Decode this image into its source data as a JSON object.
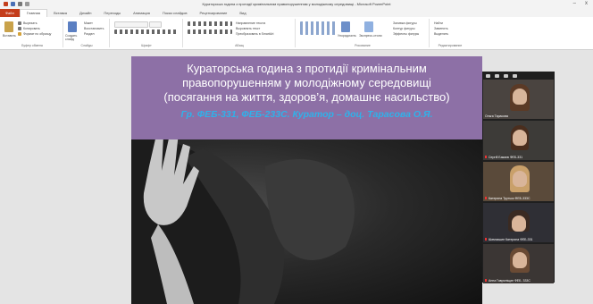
{
  "window": {
    "title": "Кураторська година з протидії кримінальним правопорушенням у молодіжному середовищі - Microsoft PowerPoint",
    "minimize": "–",
    "close": "x"
  },
  "tabs": [
    "Файл",
    "Главная",
    "Вставка",
    "Дизайн",
    "Переходы",
    "Анимация",
    "Показ слайдов",
    "Рецензирование",
    "Вид"
  ],
  "ribbon": {
    "clipboard": {
      "label": "Буфер обмена",
      "paste": "Вставить",
      "cut": "Вырезать",
      "copy": "Копировать",
      "format": "Формат по образцу"
    },
    "slides": {
      "label": "Слайды",
      "new_slide": "Создать слайд",
      "layout": "Макет",
      "reset": "Восстановить",
      "section": "Раздел"
    },
    "font": {
      "label": "Шрифт"
    },
    "paragraph": {
      "label": "Абзац",
      "text_dir": "Направление текста",
      "align_text": "Выровнять текст",
      "smartart": "Преобразовать в SmartArt"
    },
    "drawing": {
      "label": "Рисование",
      "arrange": "Упорядочить",
      "quick_styles": "Экспресс-стили",
      "fill": "Заливка фигуры",
      "outline": "Контур фигуры",
      "effects": "Эффекты фигуры"
    },
    "editing": {
      "label": "Редактирование",
      "find": "Найти",
      "replace": "Заменить",
      "select": "Выделить"
    }
  },
  "slide": {
    "title_line1": "Кураторська година з протидії кримінальним",
    "title_line2": "правопорушенням у молодіжному середовищі",
    "title_line3": "(посягання на життя, здоров’я, домашнє насильство)",
    "curator_line": "Гр. ФЕБ-331, ФЕБ-233С. Куратор – доц. Тарасова О.Я."
  },
  "participants": [
    {
      "name": "Ольга Тарасова"
    },
    {
      "name": "Сергій Бакаєв ФЕБ-331"
    },
    {
      "name": "Катерина Трутько ФЕБ-333С"
    },
    {
      "name": "Шимчишин Катерина ФЕБ-331"
    },
    {
      "name": "Анна Гавриліщин ФЕБ- 333С"
    }
  ],
  "colors": {
    "file_tab": "#c43e1c",
    "slide_header": "#8d70a6",
    "curator_text": "#2fb2ea"
  }
}
